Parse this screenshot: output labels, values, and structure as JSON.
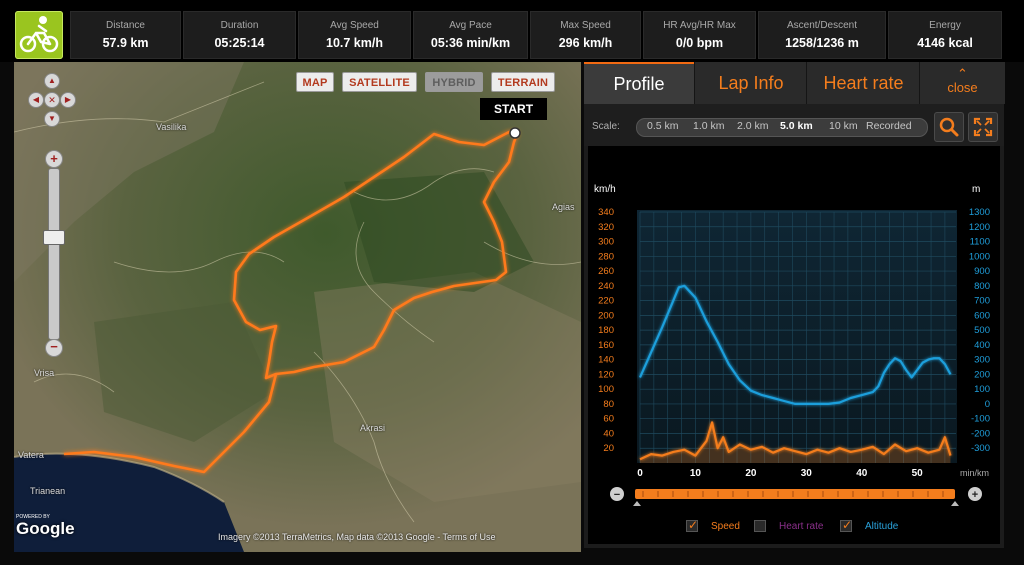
{
  "stats": [
    {
      "label": "Distance",
      "value": "57.9 km"
    },
    {
      "label": "Duration",
      "value": "05:25:14"
    },
    {
      "label": "Avg Speed",
      "value": "10.7 km/h"
    },
    {
      "label": "Avg Pace",
      "value": "05:36 min/km"
    },
    {
      "label": "Max Speed",
      "value": "296 km/h"
    },
    {
      "label": "HR Avg/HR Max",
      "value": "0/0 bpm"
    },
    {
      "label": "Ascent/Descent",
      "value": "1258/1236 m"
    },
    {
      "label": "Energy",
      "value": "4146 kcal"
    }
  ],
  "map": {
    "type_buttons": [
      "MAP",
      "SATELLITE",
      "HYBRID",
      "TERRAIN"
    ],
    "selected_type": "HYBRID",
    "start_label": "START",
    "place_labels": [
      "Vasilika",
      "Agias",
      "Akrasi",
      "Vrisa",
      "Vatera",
      "Trianean"
    ],
    "credit": "Imagery ©2013 TerraMetrics, Map data ©2013 Google - Terms of Use",
    "powered_by": "POWERED BY",
    "google": "Google",
    "route_color": "#ff7a1a"
  },
  "panel": {
    "tabs": [
      "Profile",
      "Lap Info",
      "Heart rate"
    ],
    "active_tab": "Profile",
    "close_label": "close",
    "scale_label": "Scale:",
    "scale_options": [
      "0.5 km",
      "1.0 km",
      "2.0 km",
      "5.0 km",
      "10 km",
      "Recorded"
    ],
    "selected_scale": "5.0 km",
    "legend": [
      {
        "label": "Speed",
        "checked": true,
        "color": "#f47d1d"
      },
      {
        "label": "Heart rate",
        "checked": false,
        "color": "#8a2f8a"
      },
      {
        "label": "Altitude",
        "checked": true,
        "color": "#2aa3dc"
      }
    ]
  },
  "chart_data": {
    "type": "line",
    "left_axis_label": "km/h",
    "right_axis_label": "m",
    "x_unit": "min/km",
    "x_ticks": [
      0,
      10,
      20,
      30,
      40,
      50
    ],
    "left_ticks": [
      20,
      40,
      60,
      80,
      100,
      120,
      140,
      160,
      180,
      200,
      220,
      240,
      260,
      280,
      300,
      320,
      340
    ],
    "right_ticks": [
      -300,
      -200,
      -100,
      0,
      100,
      200,
      300,
      400,
      500,
      600,
      700,
      800,
      900,
      1000,
      1100,
      1200,
      1300
    ],
    "ylim_left": [
      0,
      340
    ],
    "ylim_right": [
      -400,
      1300
    ],
    "xlim": [
      0,
      57
    ],
    "series": [
      {
        "name": "Altitude",
        "axis": "right",
        "color": "#1f9fdc",
        "x": [
          0,
          2,
          4,
          6,
          7,
          8,
          9,
          10,
          12,
          14,
          16,
          18,
          20,
          22,
          24,
          26,
          28,
          30,
          32,
          34,
          36,
          38,
          40,
          42,
          43,
          44,
          45,
          46,
          47,
          48,
          49,
          50,
          51,
          52,
          53,
          54,
          55,
          56
        ],
        "y": [
          180,
          350,
          520,
          700,
          790,
          800,
          760,
          720,
          560,
          420,
          270,
          160,
          90,
          60,
          40,
          20,
          0,
          0,
          0,
          0,
          10,
          40,
          60,
          80,
          120,
          210,
          270,
          310,
          290,
          230,
          180,
          230,
          280,
          300,
          310,
          310,
          270,
          200
        ]
      },
      {
        "name": "Speed",
        "axis": "left",
        "color": "#f47d1d",
        "x": [
          0,
          2,
          4,
          6,
          8,
          10,
          12,
          13,
          14,
          15,
          16,
          18,
          20,
          22,
          24,
          26,
          28,
          30,
          32,
          34,
          36,
          38,
          40,
          42,
          44,
          46,
          48,
          50,
          52,
          54,
          55,
          56
        ],
        "y": [
          5,
          12,
          10,
          15,
          18,
          10,
          30,
          55,
          20,
          35,
          15,
          25,
          18,
          22,
          14,
          20,
          16,
          12,
          18,
          14,
          20,
          15,
          18,
          22,
          12,
          25,
          16,
          20,
          14,
          18,
          35,
          10
        ]
      }
    ]
  }
}
